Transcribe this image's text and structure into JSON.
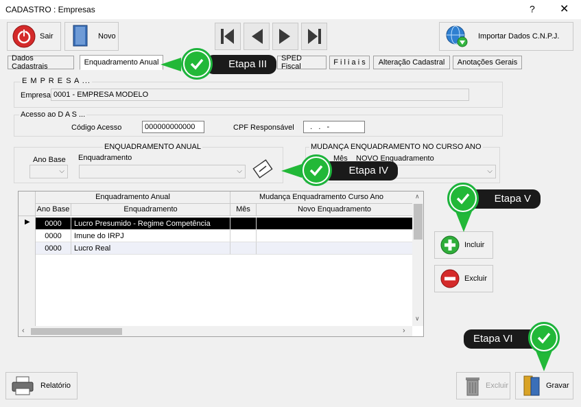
{
  "window": {
    "title": "CADASTRO : Empresas",
    "help": "?",
    "close": "✕"
  },
  "toolbar": {
    "sair": "Sair",
    "novo": "Novo",
    "importar": "Importar Dados C.N.P.J."
  },
  "tabs": [
    "Dados Cadastrais",
    "Enquadramento Anual",
    "SPED Fiscal",
    "F i l i a i s",
    "Alteração Cadastral",
    "Anotações Gerais"
  ],
  "empresa": {
    "legend": "E M P R E S A ...",
    "label": "Empresa",
    "value": "0001 - EMPRESA MODELO"
  },
  "das": {
    "legend": "Acesso ao  D A S ...",
    "codigo_label": "Código Acesso",
    "codigo_value": "000000000000",
    "cpf_label": "CPF Responsável",
    "cpf_value": "  .   .   -"
  },
  "enquadramento": {
    "legend": "ENQUADRAMENTO  ANUAL",
    "ano_label": "Ano Base",
    "enq_label": "Enquadramento"
  },
  "mudanca": {
    "legend": "MUDANÇA  ENQUADRAMENTO NO CURSO ANO",
    "mes_label": "Mês",
    "novo_label": "NOVO  Enquadramento"
  },
  "grid": {
    "group1": "Enquadramento Anual",
    "group2": "Mudança Enquadramento Curso Ano",
    "columns": [
      "Ano Base",
      "Enquadramento",
      "Mês",
      "Novo Enquadramento"
    ],
    "rows": [
      {
        "ano": "0000",
        "enq": "Lucro Presumido - Regime Competência",
        "mes": "",
        "novo": ""
      },
      {
        "ano": "0000",
        "enq": "Imune do IRPJ",
        "mes": "",
        "novo": ""
      },
      {
        "ano": "0000",
        "enq": "Lucro Real",
        "mes": "",
        "novo": ""
      }
    ]
  },
  "actions": {
    "incluir": "Incluir",
    "excluir": "Excluir"
  },
  "footer": {
    "relatorio": "Relatório",
    "excluir": "Excluir",
    "gravar": "Gravar"
  },
  "callouts": {
    "etapa3": "Etapa III",
    "etapa4": "Etapa IV",
    "etapa5": "Etapa V",
    "etapa6": "Etapa VI"
  },
  "colors": {
    "green": "#22b838",
    "callout": "#1a1a1a",
    "selected_row": "#000000"
  }
}
